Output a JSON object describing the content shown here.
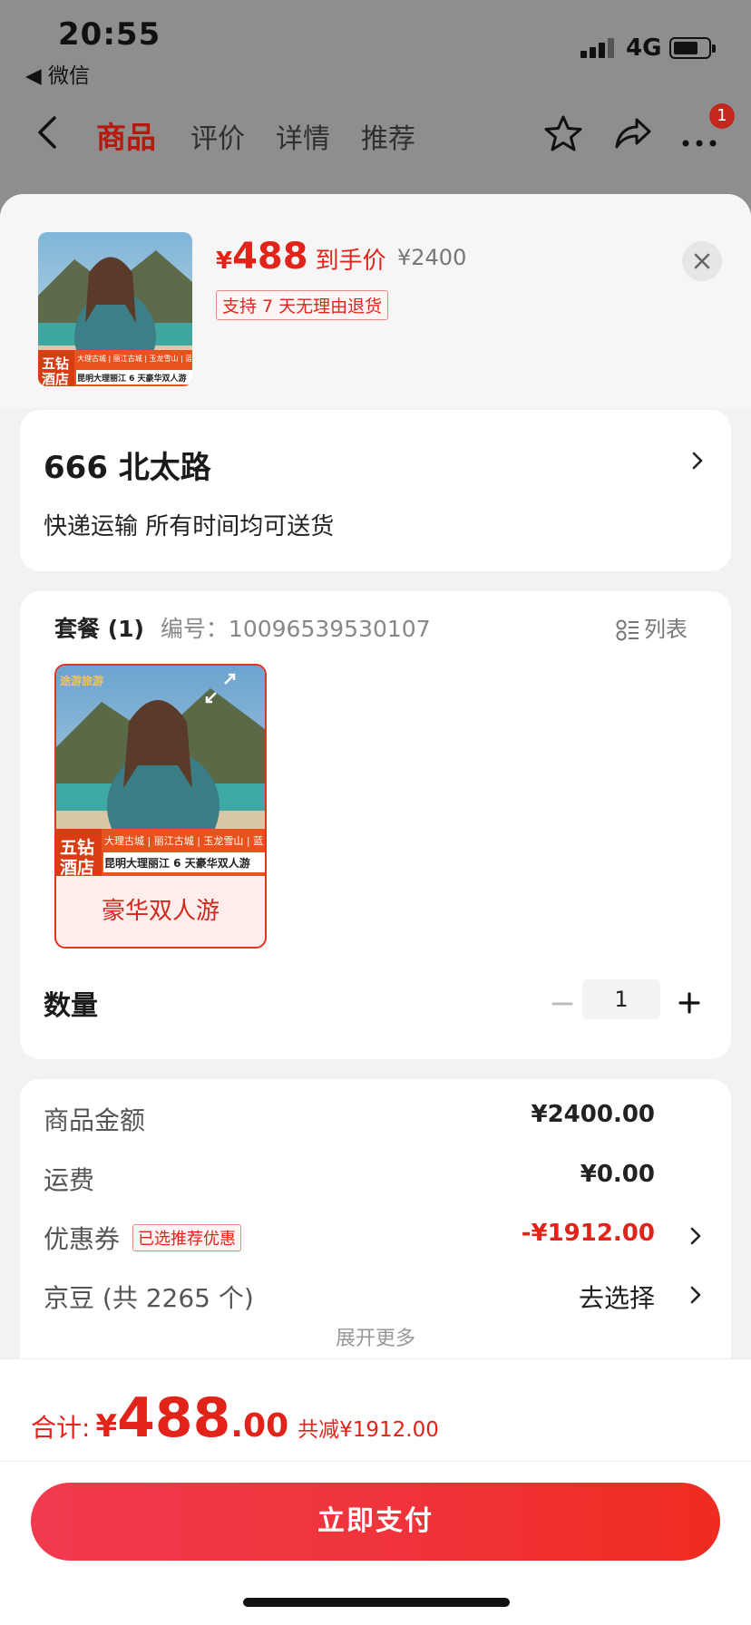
{
  "status": {
    "time": "20:55",
    "back_app": "◀ 微信",
    "network": "4G"
  },
  "nav": {
    "tabs": [
      {
        "label": "商品",
        "active": true
      },
      {
        "label": "评价",
        "active": false
      },
      {
        "label": "详情",
        "active": false
      },
      {
        "label": "推荐",
        "active": false
      }
    ],
    "badge": "1"
  },
  "product": {
    "price_symbol": "¥",
    "price": "488",
    "price_tag": "到手价",
    "original_price": "¥2400",
    "return_policy": "支持 7 天无理由退货",
    "thumb_badge": [
      "五钻",
      "酒店"
    ],
    "thumb_route": "昆明大理丽江 6 天豪华双人游",
    "thumb_spots": "大理古城 | 丽江古城 | 玉龙雪山 | 蓝月谷"
  },
  "address": {
    "title": "666  北太路",
    "delivery": "快递运输 所有时间均可送货"
  },
  "package": {
    "title": "套餐 (1)",
    "code_label": "编号：",
    "code": "10096539530107",
    "list_label": "列表",
    "item_label": "豪华双人游",
    "item_brand": "途游旅游",
    "quantity_label": "数量",
    "quantity": "1"
  },
  "fees": {
    "goods_label": "商品金额",
    "goods_value": "¥2400.00",
    "shipping_label": "运费",
    "shipping_value": "¥0.00",
    "coupon_label": "优惠券",
    "coupon_tag": "已选推荐优惠",
    "coupon_value": "-¥1912.00",
    "beans_label": "京豆 (共 2265 个)",
    "beans_action": "去选择",
    "expand_label": "展开更多"
  },
  "footer": {
    "total_label": "合计:",
    "total_symbol": "¥",
    "total_int": "488",
    "total_dec": ".00",
    "saved": "共减¥1912.00",
    "pay_label": "立即支付"
  },
  "colors": {
    "accent": "#e2231a",
    "pay_gradient_start": "#f23a4f",
    "pay_gradient_end": "#ef2c20"
  }
}
